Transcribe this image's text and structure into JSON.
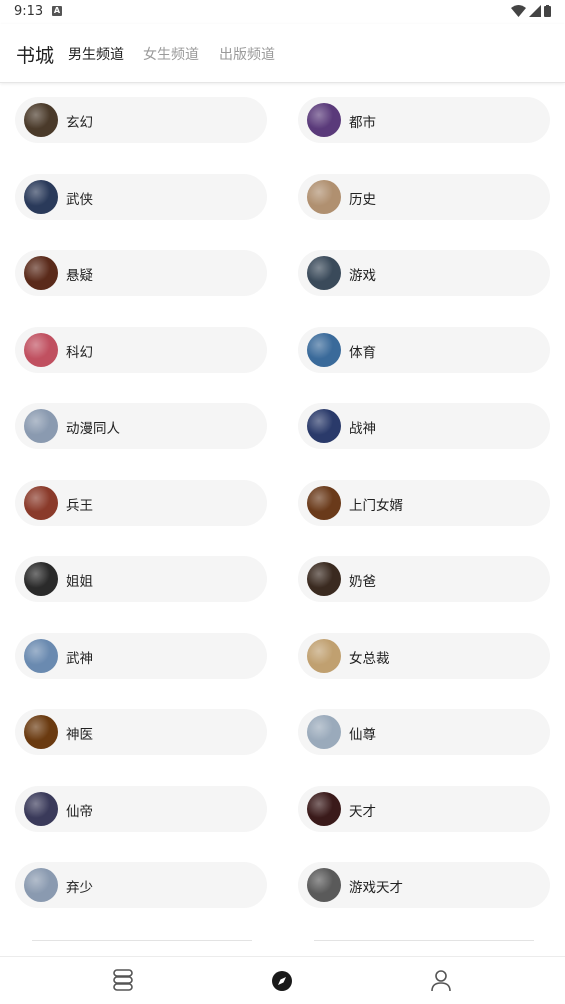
{
  "status": {
    "time": "9:13",
    "notification_icon": "a-notification-icon"
  },
  "header": {
    "title": "书城",
    "tabs": [
      {
        "label": "男生频道",
        "active": true
      },
      {
        "label": "女生频道",
        "active": false
      },
      {
        "label": "出版频道",
        "active": false
      }
    ]
  },
  "categories": [
    {
      "label": "玄幻",
      "color": "#4a3a2a"
    },
    {
      "label": "都市",
      "color": "#5a3a7a"
    },
    {
      "label": "武侠",
      "color": "#2a3a5a"
    },
    {
      "label": "历史",
      "color": "#b09070"
    },
    {
      "label": "悬疑",
      "color": "#5a2a1a"
    },
    {
      "label": "游戏",
      "color": "#3a4a5a"
    },
    {
      "label": "科幻",
      "color": "#c05060"
    },
    {
      "label": "体育",
      "color": "#3a6a9a"
    },
    {
      "label": "动漫同人",
      "color": "#8a9ab0"
    },
    {
      "label": "战神",
      "color": "#2a3a6a"
    },
    {
      "label": "兵王",
      "color": "#8a3a2a"
    },
    {
      "label": "上门女婿",
      "color": "#6a3a1a"
    },
    {
      "label": "姐姐",
      "color": "#2a2a2a"
    },
    {
      "label": "奶爸",
      "color": "#3a2a20"
    },
    {
      "label": "武神",
      "color": "#6a8ab0"
    },
    {
      "label": "女总裁",
      "color": "#c0a070"
    },
    {
      "label": "神医",
      "color": "#6a3a10"
    },
    {
      "label": "仙尊",
      "color": "#9aaabb"
    },
    {
      "label": "仙帝",
      "color": "#3a3a5a"
    },
    {
      "label": "天才",
      "color": "#3a1a1a"
    },
    {
      "label": "弃少",
      "color": "#8a9ab0"
    },
    {
      "label": "游戏天才",
      "color": "#5a5a5a"
    }
  ],
  "bottom_nav": [
    {
      "name": "bookshelf-icon",
      "active": false
    },
    {
      "name": "compass-icon",
      "active": true
    },
    {
      "name": "profile-icon",
      "active": false
    }
  ]
}
